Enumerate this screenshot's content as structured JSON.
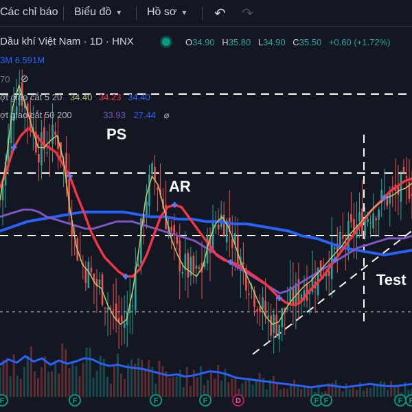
{
  "toolbar": {
    "indicators_label": "Các chỉ báo",
    "chart_label": "Biểu đồ",
    "profile_label": "Hồ sơ"
  },
  "legend": {
    "symbol_line": "Dầu khí Việt Nam · 1D · HNX",
    "o_key": "O",
    "o_val": "34.90",
    "h_key": "H",
    "h_val": "35.80",
    "l_key": "L",
    "l_val": "34.90",
    "c_key": "C",
    "c_val": "35.50",
    "change": "+0.60 (+1.72%)",
    "volume_cut": "3M",
    "volume_value": "6.591M",
    "row3_cut": "70",
    "ma1_label": "ợt giao cắt 5 20",
    "ma1_v1": "34.40",
    "ma1_v2": "34.23",
    "ma1_v3": "34.40",
    "ma2_label": "ợt giao cắt 50 200",
    "ma2_v1": "33.93",
    "ma2_v2": "27.44",
    "ma2_v3": "⌀"
  },
  "annotations": {
    "ps": "PS",
    "ar": "AR",
    "test": "Test"
  },
  "event_badges": [
    "F",
    "F",
    "F",
    "F",
    "D",
    "F",
    "F",
    "F",
    "F"
  ],
  "colors": {
    "background": "#131722",
    "up": "#26a69a",
    "down": "#ef5350",
    "ma_fast": "#f23645",
    "ma_mid": "#7e57c2",
    "ma_slow": "#2962ff",
    "volume_line": "#2962ff",
    "candle_sample": "#26a69a"
  },
  "chart_data": {
    "type": "line",
    "series": [
      {
        "name": "5",
        "values": [
          33.5,
          35.2,
          37.4,
          38.3,
          37.5,
          36.6,
          35.7,
          35.7,
          36.0,
          36.2,
          35.2,
          33.2,
          31.6,
          30.8,
          30.5,
          30.0,
          29.8,
          29.1,
          28.6,
          28.3,
          28.5,
          29.8,
          31.6,
          33.6,
          34.5,
          34.1,
          33.0,
          31.9,
          31.2,
          30.7,
          30.5,
          30.3,
          30.7,
          31.8,
          32.5,
          32.8,
          32.4,
          31.7,
          30.9,
          30.3,
          29.7,
          29.1,
          28.6,
          28.3,
          28.4,
          28.9,
          29.3,
          29.6,
          29.9,
          30.1,
          30.4,
          30.7,
          31.0,
          31.3,
          31.6,
          32.0,
          32.3,
          32.6,
          32.9,
          33.2,
          33.4,
          33.6,
          33.7,
          33.9,
          34.0,
          34.2
        ]
      },
      {
        "name": "20",
        "values": [
          34.0,
          34.8,
          35.7,
          36.2,
          36.5,
          36.3,
          35.9,
          35.7,
          35.5,
          35.0,
          34.5,
          33.7,
          33.0,
          32.2,
          31.6,
          31.1,
          30.8,
          30.5,
          30.3,
          30.3,
          30.6,
          31.2,
          32.0,
          32.8,
          33.2,
          33.3,
          33.2,
          32.8,
          32.4,
          32.0,
          31.6,
          31.2,
          31.0,
          30.9,
          30.8,
          30.6,
          30.4,
          30.2,
          30.0,
          29.7,
          29.4,
          29.2,
          29.1,
          29.2,
          29.6,
          29.9,
          30.2,
          30.6,
          31.0,
          31.4,
          31.8,
          32.2,
          32.6,
          33.0,
          33.3,
          33.6,
          33.9,
          34.1,
          34.3,
          34.4
        ]
      },
      {
        "name": "50",
        "values": [
          32.8,
          32.9,
          33.0,
          33.1,
          33.1,
          33.0,
          32.8,
          32.7,
          32.6,
          32.5,
          32.4,
          32.3,
          32.3,
          32.4,
          32.5,
          32.6,
          32.6,
          32.6,
          32.5,
          32.4,
          32.3,
          32.2,
          32.1,
          32.0,
          31.9,
          31.8,
          31.6,
          31.4,
          31.2,
          31.0,
          30.8,
          30.6,
          30.4,
          30.2,
          30.0,
          29.8,
          29.6,
          29.7,
          29.9,
          30.1,
          30.3,
          30.5,
          30.7,
          30.9,
          31.1,
          31.3,
          31.5,
          31.6,
          31.7,
          31.8,
          31.9,
          31.9,
          31.9,
          32.0
        ]
      },
      {
        "name": "200",
        "values": [
          32.2,
          32.4,
          32.6,
          32.7,
          32.8,
          32.9,
          33.0,
          33.0,
          33.0,
          33.0,
          32.9,
          32.8,
          32.8,
          32.7,
          32.7,
          32.6,
          32.6,
          32.5,
          32.5,
          32.4,
          32.3,
          32.2,
          32.0,
          31.9,
          31.7,
          31.5,
          31.4,
          31.3,
          31.2,
          31.3,
          31.4
        ]
      }
    ],
    "volume_series": [
      0.3,
      0.35,
      0.32,
      0.38,
      0.33,
      0.36,
      0.3,
      0.34,
      0.31,
      0.33,
      0.36,
      0.35,
      0.31,
      0.29,
      0.3,
      0.28,
      0.27,
      0.26,
      0.24,
      0.22,
      0.2,
      0.21,
      0.19,
      0.2,
      0.22,
      0.24,
      0.23,
      0.21,
      0.18,
      0.17,
      0.16,
      0.15,
      0.14,
      0.13,
      0.12,
      0.11,
      0.1,
      0.09,
      0.1,
      0.11,
      0.1,
      0.09,
      0.1,
      0.11,
      0.12,
      0.11,
      0.1,
      0.1,
      0.11,
      0.12
    ]
  }
}
